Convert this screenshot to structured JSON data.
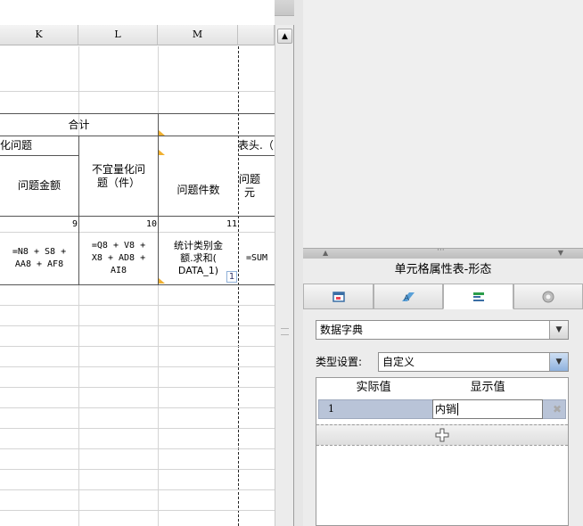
{
  "spreadsheet": {
    "columns": [
      "K",
      "L",
      "M"
    ],
    "cells": {
      "heji": "合计",
      "wenti_partial": "化问题",
      "biaotou_partial": "表头.（",
      "wenti_jine": "问题金额",
      "buyi_lianghua": "不宜量化问\n题（件）",
      "wenti_jianshu": "问题件数",
      "wenti_partial2": "问题\n元",
      "num9": "9",
      "num10": "10",
      "num11": "11",
      "formula_k": "=N8 + S8 +\nAA8 + AF8",
      "formula_l": "=Q8 + V8 +\nX8 + AD8 +\nAI8",
      "formula_m1": "统计类别金\n额.求和(\nDATA_1)",
      "formula_m_badge": "1",
      "formula_n": "=SUM"
    }
  },
  "panel": {
    "title": "单元格属性表-形态",
    "tabs": [
      "cell-style",
      "format",
      "form-control",
      "advanced-settings"
    ],
    "widget_type": "数据字典",
    "type_label": "类型设置:",
    "type_value": "自定义",
    "grid": {
      "header_actual": "实际值",
      "header_display": "显示值",
      "rows": [
        {
          "actual": "1",
          "display": "内销"
        }
      ]
    }
  },
  "colors": {
    "selected_tab": "#ffffff",
    "grid_row": "#b9c4d8",
    "marker": "#f0b030"
  }
}
